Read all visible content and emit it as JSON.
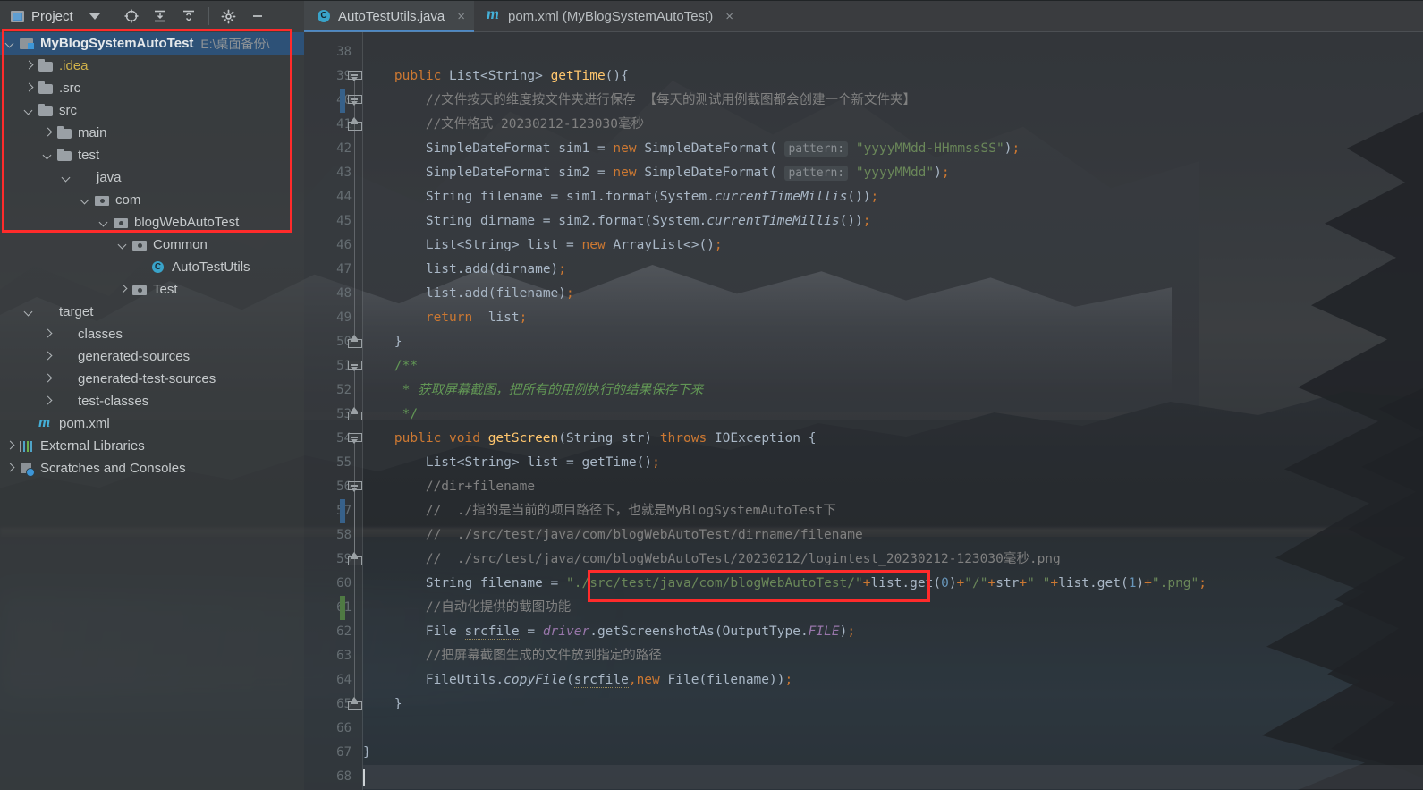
{
  "toolbar": {
    "project_label": "Project",
    "icons": [
      {
        "name": "locate-icon",
        "glyph": "locate"
      },
      {
        "name": "expand-all-icon",
        "glyph": "expand-all"
      },
      {
        "name": "collapse-all-icon",
        "glyph": "collapse-all"
      },
      {
        "name": "settings-gear-icon",
        "glyph": "gear"
      },
      {
        "name": "hide-panel-icon",
        "glyph": "minus"
      }
    ]
  },
  "sidebar": {
    "items": [
      {
        "label": "MyBlogSystemAutoTest",
        "path_hint": "E:\\桌面备份\\",
        "indent": 0,
        "arrow": "open",
        "icon": "module",
        "selected": true,
        "bold": true,
        "name": "tree-item-myblogsystemautotest"
      },
      {
        "label": ".idea",
        "path_hint": "",
        "indent": 1,
        "arrow": "closed",
        "icon": "folder",
        "yellow": true,
        "name": "tree-item-idea"
      },
      {
        "label": ".src",
        "path_hint": "",
        "indent": 1,
        "arrow": "closed",
        "icon": "folder",
        "name": "tree-item-dot-src"
      },
      {
        "label": "src",
        "path_hint": "",
        "indent": 1,
        "arrow": "open",
        "icon": "folder",
        "name": "tree-item-src"
      },
      {
        "label": "main",
        "path_hint": "",
        "indent": 2,
        "arrow": "closed",
        "icon": "folder",
        "name": "tree-item-main"
      },
      {
        "label": "test",
        "path_hint": "",
        "indent": 2,
        "arrow": "open",
        "icon": "folder",
        "name": "tree-item-test"
      },
      {
        "label": "java",
        "path_hint": "",
        "indent": 3,
        "arrow": "open",
        "icon": "folder-green",
        "name": "tree-item-java"
      },
      {
        "label": "com",
        "path_hint": "",
        "indent": 4,
        "arrow": "open",
        "icon": "pkg",
        "name": "tree-item-com"
      },
      {
        "label": "blogWebAutoTest",
        "path_hint": "",
        "indent": 5,
        "arrow": "open",
        "icon": "pkg",
        "name": "tree-item-blogwebautotest"
      },
      {
        "label": "Common",
        "path_hint": "",
        "indent": 6,
        "arrow": "open",
        "icon": "pkg",
        "name": "tree-item-common"
      },
      {
        "label": "AutoTestUtils",
        "path_hint": "",
        "indent": 7,
        "arrow": "none",
        "icon": "cls",
        "name": "tree-item-autotestutils"
      },
      {
        "label": "Test",
        "path_hint": "",
        "indent": 6,
        "arrow": "closed",
        "icon": "pkg",
        "name": "tree-item-test-pkg"
      },
      {
        "label": "target",
        "path_hint": "",
        "indent": 1,
        "arrow": "open",
        "icon": "folder-orange",
        "name": "tree-item-target"
      },
      {
        "label": "classes",
        "path_hint": "",
        "indent": 2,
        "arrow": "closed",
        "icon": "folder-orange",
        "name": "tree-item-classes"
      },
      {
        "label": "generated-sources",
        "path_hint": "",
        "indent": 2,
        "arrow": "closed",
        "icon": "folder-orange",
        "name": "tree-item-generated-sources"
      },
      {
        "label": "generated-test-sources",
        "path_hint": "",
        "indent": 2,
        "arrow": "closed",
        "icon": "folder-orange",
        "name": "tree-item-generated-test-sources"
      },
      {
        "label": "test-classes",
        "path_hint": "",
        "indent": 2,
        "arrow": "closed",
        "icon": "folder-orange",
        "name": "tree-item-test-classes"
      },
      {
        "label": "pom.xml",
        "path_hint": "",
        "indent": 1,
        "arrow": "none",
        "icon": "maven",
        "name": "tree-item-pom-xml"
      },
      {
        "label": "External Libraries",
        "path_hint": "",
        "indent": 0,
        "arrow": "closed",
        "icon": "libs",
        "name": "tree-item-external-libraries"
      },
      {
        "label": "Scratches and Consoles",
        "path_hint": "",
        "indent": 0,
        "arrow": "closed",
        "icon": "scratch",
        "name": "tree-item-scratches-and-consoles"
      }
    ]
  },
  "editor": {
    "tabs": [
      {
        "label": "AutoTestUtils.java",
        "icon": "java-class-icon",
        "active": true,
        "close": "×",
        "name": "tab-autotestutils-java"
      },
      {
        "label": "pom.xml (MyBlogSystemAutoTest)",
        "icon": "maven-icon",
        "active": false,
        "close": "×",
        "name": "tab-pom-xml"
      }
    ],
    "first_line_number": 38,
    "last_line_number": 68,
    "current_line": 68,
    "lines": [
      {
        "n": 38,
        "text": "",
        "fold": "none",
        "vcs": "none"
      },
      {
        "n": 39,
        "text": "    public List<String> getTime(){",
        "fold": "coll",
        "vcs": "none"
      },
      {
        "n": 40,
        "text": "        //文件按天的维度按文件夹进行保存 【每天的测试用例截图都会创建一个新文件夹】",
        "fold": "coll",
        "vcs": "changed"
      },
      {
        "n": 41,
        "text": "        //文件格式 20230212-123030毫秒",
        "fold": "end",
        "vcs": "none"
      },
      {
        "n": 42,
        "text": "        SimpleDateFormat sim1 = new SimpleDateFormat( pattern: \"yyyyMMdd-HHmmssSS\");",
        "fold": "none",
        "vcs": "none"
      },
      {
        "n": 43,
        "text": "        SimpleDateFormat sim2 = new SimpleDateFormat( pattern: \"yyyyMMdd\");",
        "fold": "none",
        "vcs": "none"
      },
      {
        "n": 44,
        "text": "        String filename = sim1.format(System.currentTimeMillis());",
        "fold": "none",
        "vcs": "none"
      },
      {
        "n": 45,
        "text": "        String dirname = sim2.format(System.currentTimeMillis());",
        "fold": "none",
        "vcs": "none"
      },
      {
        "n": 46,
        "text": "        List<String> list = new ArrayList<>();",
        "fold": "none",
        "vcs": "none"
      },
      {
        "n": 47,
        "text": "        list.add(dirname);",
        "fold": "none",
        "vcs": "none"
      },
      {
        "n": 48,
        "text": "        list.add(filename);",
        "fold": "none",
        "vcs": "none"
      },
      {
        "n": 49,
        "text": "        return  list;",
        "fold": "none",
        "vcs": "none"
      },
      {
        "n": 50,
        "text": "    }",
        "fold": "end",
        "vcs": "none"
      },
      {
        "n": 51,
        "text": "    /**",
        "fold": "coll",
        "vcs": "none"
      },
      {
        "n": 52,
        "text": "     * 获取屏幕截图，把所有的用例执行的结果保存下来",
        "fold": "none",
        "vcs": "none"
      },
      {
        "n": 53,
        "text": "     */",
        "fold": "end",
        "vcs": "none"
      },
      {
        "n": 54,
        "text": "    public void getScreen(String str) throws IOException {",
        "fold": "coll",
        "vcs": "none"
      },
      {
        "n": 55,
        "text": "        List<String> list = getTime();",
        "fold": "none",
        "vcs": "none"
      },
      {
        "n": 56,
        "text": "        //dir+filename",
        "fold": "coll",
        "vcs": "none"
      },
      {
        "n": 57,
        "text": "        //  ./指的是当前的项目路径下，也就是MyBlogSystemAutoTest下",
        "fold": "none",
        "vcs": "changed"
      },
      {
        "n": 58,
        "text": "        //  ./src/test/java/com/blogWebAutoTest/dirname/filename",
        "fold": "none",
        "vcs": "none"
      },
      {
        "n": 59,
        "text": "        //  ./src/test/java/com/blogWebAutoTest/20230212/logintest_20230212-123030毫秒.png",
        "fold": "end",
        "vcs": "none"
      },
      {
        "n": 60,
        "text": "        String filename = \"./src/test/java/com/blogWebAutoTest/\"+list.get(0)+\"/\"+str+\"_\"+list.get(1)+\".png\";",
        "fold": "none",
        "vcs": "none"
      },
      {
        "n": 61,
        "text": "        //自动化提供的截图功能",
        "fold": "none",
        "vcs": "added"
      },
      {
        "n": 62,
        "text": "        File srcfile = driver.getScreenshotAs(OutputType.FILE);",
        "fold": "none",
        "vcs": "none"
      },
      {
        "n": 63,
        "text": "        //把屏幕截图生成的文件放到指定的路径",
        "fold": "none",
        "vcs": "none"
      },
      {
        "n": 64,
        "text": "        FileUtils.copyFile(srcfile,new File(filename));",
        "fold": "none",
        "vcs": "none"
      },
      {
        "n": 65,
        "text": "    }",
        "fold": "end",
        "vcs": "none"
      },
      {
        "n": 66,
        "text": "",
        "fold": "none",
        "vcs": "none"
      },
      {
        "n": 67,
        "text": "}",
        "fold": "none",
        "vcs": "none"
      },
      {
        "n": 68,
        "text": "",
        "fold": "none",
        "vcs": "none"
      }
    ],
    "inlay_hints": [
      "pattern:",
      "pattern:"
    ]
  },
  "annotations": [
    {
      "name": "annotation-box-project-tree",
      "color": "#ff2b2b"
    },
    {
      "name": "annotation-box-path-string",
      "color": "#ff2b2b"
    }
  ],
  "colors": {
    "accent_blue": "#4a88c7",
    "selection_blue": "#2d5177",
    "annotation_red": "#ff2b2b",
    "string_green": "#6a8759",
    "keyword_orange": "#cc7832",
    "comment_gray": "#808080",
    "method_yellow": "#ffc66d",
    "field_purple": "#9876aa",
    "number_blue": "#6897bb",
    "doc_green": "#629755"
  }
}
